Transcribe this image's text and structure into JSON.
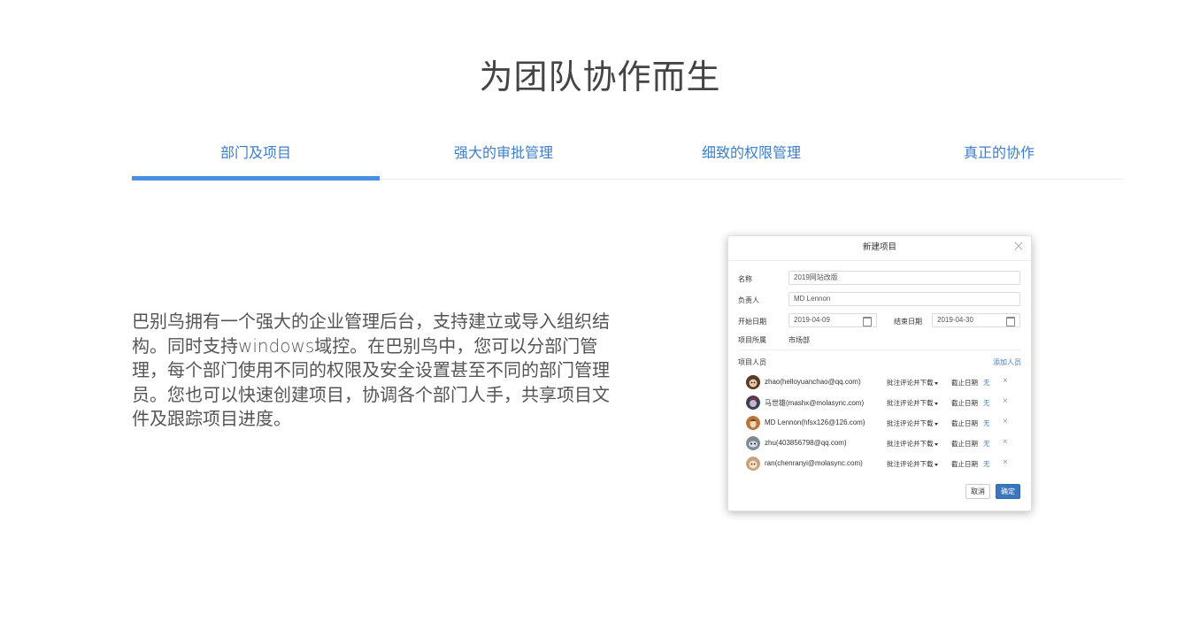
{
  "page": {
    "title": "为团队协作而生"
  },
  "tabs": [
    {
      "label": "部门及项目",
      "active": true
    },
    {
      "label": "强大的审批管理",
      "active": false
    },
    {
      "label": "细致的权限管理",
      "active": false
    },
    {
      "label": "真正的协作",
      "active": false
    }
  ],
  "description": "巴别鸟拥有一个强大的企业管理后台，支持建立或导入组织结构。同时支持windows域控。在巴别鸟中，您可以分部门管理，每个部门使用不同的权限及安全设置甚至不同的部门管理员。您也可以快速创建项目，协调各个部门人手，共享项目文件及跟踪项目进度。",
  "dialog": {
    "title": "新建项目",
    "close_icon": "close-icon",
    "name_label": "名称",
    "name_value": "2019网站改版",
    "owner_label": "负责人",
    "owner_value": "MD Lennon",
    "start_label": "开始日期",
    "start_value": "2019-04-09",
    "end_label": "结束日期",
    "end_value": "2019-04-30",
    "dept_label": "项目所属",
    "dept_value": "市场部",
    "members_label": "项目人员",
    "add_member": "添加人员",
    "members": [
      {
        "name": "zhao(helloyuanchao@qq.com)",
        "perm": "批注评论并下载",
        "deadline_label": "截止日期",
        "deadline": "无",
        "avatar_color": "#5a3b2a"
      },
      {
        "name": "马世雄(mashx@molasync.com)",
        "perm": "批注评论并下载",
        "deadline_label": "截止日期",
        "deadline": "无",
        "avatar_color": "#3b3f5a"
      },
      {
        "name": "MD Lennon(hfsx126@126.com)",
        "perm": "批注评论并下载",
        "deadline_label": "截止日期",
        "deadline": "无",
        "avatar_color": "#b8743a"
      },
      {
        "name": "zhu(403856798@qq.com)",
        "perm": "批注评论并下载",
        "deadline_label": "截止日期",
        "deadline": "无",
        "avatar_color": "#7d8a95"
      },
      {
        "name": "ran(chenranyi@molasync.com)",
        "perm": "批注评论并下载",
        "deadline_label": "截止日期",
        "deadline": "无",
        "avatar_color": "#c9a27a"
      }
    ],
    "remove_icon": "×",
    "cancel_label": "取消",
    "ok_label": "确定"
  },
  "colors": {
    "accent": "#4a90e2",
    "link": "#3c7fc8",
    "primary_button": "#3a76bf"
  }
}
